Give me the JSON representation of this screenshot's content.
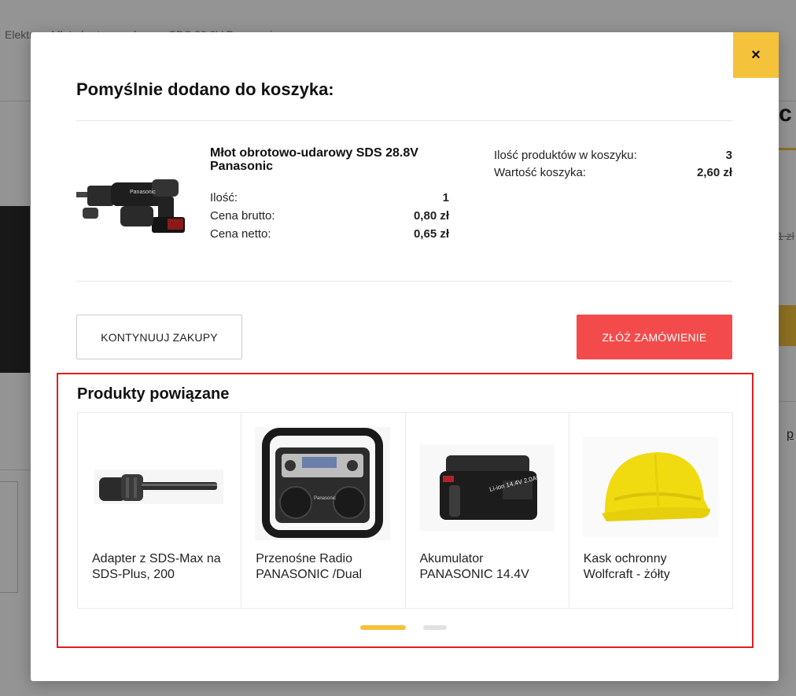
{
  "background": {
    "breadcrumb": "Elektr... › Młot obrotowo-udarowy SDS 28.8V Panasonic"
  },
  "modal": {
    "close_label": "×",
    "title": "Pomyślnie dodano do koszyka:",
    "product": {
      "name": "Młot obrotowo-udarowy SDS 28.8V Panasonic",
      "image_icon": "rotary-hammer-image",
      "quantity_label": "Ilość:",
      "quantity_value": "1",
      "gross_label": "Cena brutto:",
      "gross_value": "0,80 zł",
      "net_label": "Cena netto:",
      "net_value": "0,65 zł"
    },
    "cart": {
      "items_label": "Ilość produktów w koszyku:",
      "items_value": "3",
      "total_label": "Wartość koszyka:",
      "total_value": "2,60 zł"
    },
    "continue_label": "KONTYNUUJ ZAKUPY",
    "order_label": "ZŁÓŻ ZAMÓWIENIE",
    "related": {
      "title": "Produkty powiązane",
      "items": [
        {
          "name": "Adapter z SDS-Max na SDS-Plus, 200",
          "icon": "sds-adapter-image"
        },
        {
          "name": "Przenośne Radio PANASONIC /Dual",
          "icon": "radio-image"
        },
        {
          "name": "Akumulator PANASONIC 14.4V",
          "icon": "battery-image"
        },
        {
          "name": "Kask ochronny Wolfcraft - żółty",
          "icon": "helmet-image"
        }
      ],
      "battery_label": "Li-ion 14.4V 2.0Ah",
      "radio_brand": "Panasonic"
    }
  },
  "colors": {
    "accent_yellow": "#f5c23b",
    "order_red": "#f34b4b",
    "highlight_border": "#e01e1e"
  }
}
